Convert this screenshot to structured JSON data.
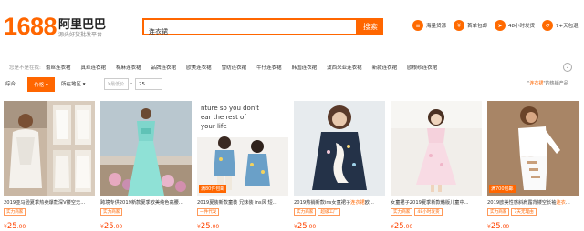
{
  "header": {
    "logo_number": "1688",
    "logo_name": "阿里巴巴",
    "logo_sub": "源头好货批发平台",
    "search_value": "连衣裙",
    "search_button": "搜索",
    "features": [
      {
        "icon": "stack-icon",
        "label": "海量货源"
      },
      {
        "icon": "tag-icon",
        "label": "首单包邮"
      },
      {
        "icon": "truck-icon",
        "label": "48小时发货"
      },
      {
        "icon": "return-icon",
        "label": "7+天包退"
      }
    ]
  },
  "category": {
    "title": "您是不是在找:",
    "items": [
      "蕾丝连衣裙",
      "真丝连衣裙",
      "棉麻连衣裙",
      "品牌连衣裙",
      "欧美连衣裙",
      "雪纺连衣裙",
      "牛仔连衣裙",
      "韩国连衣裙",
      "波西米亚连衣裙",
      "新款连衣裙",
      "欧根纱连衣裙"
    ]
  },
  "filters": {
    "synthesis": "综合",
    "price": "价格 ▾",
    "location": "所在地区 ▾",
    "min_placeholder": "¥最低价",
    "dash": "-",
    "max_value": "25",
    "related_prefix": "\"",
    "related_keyword": "连衣裙",
    "related_suffix": "\"的热销产品"
  },
  "products": [
    {
      "title_pre": "2019亚马逊夏季热卖爆款深V镂空无...",
      "title_hl": "",
      "tags": [
        "实力商家"
      ],
      "badge": "",
      "price_int": "25",
      "price_dec": ".00"
    },
    {
      "title_pre": "跨境专供2019新款夏季欧美纯色高腰...",
      "title_hl": "",
      "tags": [
        "实力商家"
      ],
      "badge": "",
      "price_int": "25",
      "price_dec": ".00"
    },
    {
      "title_pre": "2019夏装新款童装 兄妹装 ins风 短...",
      "title_hl": "",
      "tags": [
        "一件代发"
      ],
      "badge": "满80件包邮",
      "price_int": "25",
      "price_dec": ".00"
    },
    {
      "title_pre": "2019热销新款ins女童裙子",
      "title_hl": "连衣裙",
      "title_post": "欧...",
      "tags": [
        "实力商家",
        "超级工厂"
      ],
      "badge": "",
      "price_int": "25",
      "price_dec": ".00"
    },
    {
      "title_pre": "女童裙子2019夏季新款韩版儿童中...",
      "title_hl": "",
      "tags": [
        "实力商家",
        "48小时发货"
      ],
      "badge": "",
      "price_int": "25",
      "price_dec": ".00"
    },
    {
      "title_pre": "2019欧美性感斜肩露背镂空长袖",
      "title_hl": "连衣",
      "title_post": "...",
      "tags": [
        "实力商家",
        "7天无理由"
      ],
      "badge": "满700包邮",
      "price_int": "25",
      "price_dec": ".00"
    }
  ],
  "colors": {
    "accent": "#ff6600",
    "price": "#ff4400"
  }
}
